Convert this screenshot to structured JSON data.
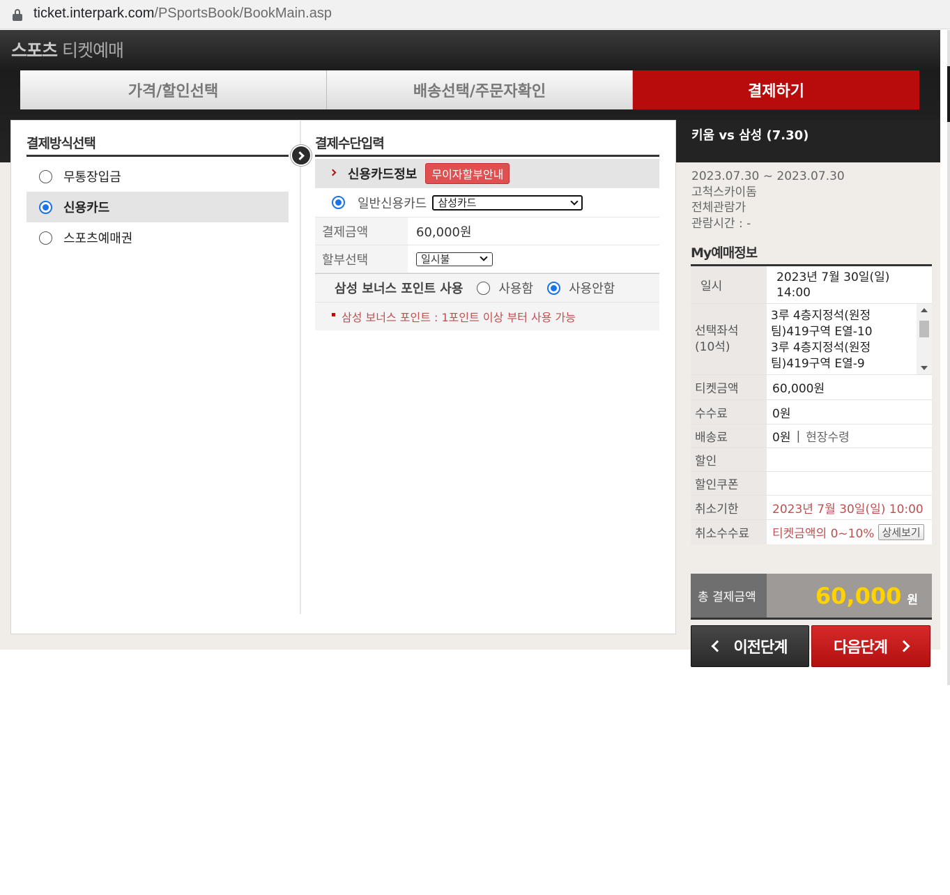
{
  "browser": {
    "url_host": "ticket.interpark.com",
    "url_path": "/PSportsBook/BookMain.asp"
  },
  "header": {
    "brand_bold": "스포츠",
    "brand_light": " 티켓예매"
  },
  "steps": [
    {
      "label": "가격/할인선택",
      "active": false
    },
    {
      "label": "배송선택/주문자확인",
      "active": false
    },
    {
      "label": "결제하기",
      "active": true
    }
  ],
  "payment_methods": {
    "title": "결제방식선택",
    "items": [
      {
        "label": "무통장입금",
        "selected": false
      },
      {
        "label": "신용카드",
        "selected": true
      },
      {
        "label": "스포츠예매권",
        "selected": false
      }
    ]
  },
  "payment_input": {
    "title": "결제수단입력",
    "card_info_label": "신용카드정보",
    "interest_free_badge": "무이자할부안내",
    "card_type_label": "일반신용카드",
    "card_select_value": "삼성카드",
    "amount_label": "결제금액",
    "amount_value": "60,000원",
    "installment_label": "할부선택",
    "installment_value": "일시불",
    "bonus_label": "삼성 보너스 포인트 사용",
    "bonus_use": "사용함",
    "bonus_nouse": "사용안함",
    "bonus_note": "삼성 보너스 포인트 : 1포인트 이상 부터 사용 가능"
  },
  "match": {
    "title": "키움 vs 삼성 (7.30)",
    "period": "2023.07.30 ~ 2023.07.30",
    "venue": "고척스카이돔",
    "rating": "전체관람가",
    "runtime": "관람시간 : -"
  },
  "my_booking": {
    "title": "My예매정보",
    "datetime_label": "일시",
    "datetime_value_1": "2023년 7월 30일(일)",
    "datetime_value_2": "14:00",
    "seat_label_1": "선택좌석",
    "seat_label_2": "(10석)",
    "seats": [
      "3루 4층지정석(원정",
      "팀)419구역 E열-10",
      "3루 4층지정석(원정",
      "팀)419구역 E열-9"
    ],
    "ticket_label": "티켓금액",
    "ticket_value": "60,000원",
    "fee_label": "수수료",
    "fee_value": "0원",
    "delivery_label": "배송료",
    "delivery_value": "0원",
    "delivery_method": "현장수령",
    "discount_label": "할인",
    "coupon_label": "할인쿠폰",
    "cancel_deadline_label": "취소기한",
    "cancel_deadline_value": "2023년 7월 30일(일) 10:00",
    "cancel_fee_label": "취소수수료",
    "cancel_fee_value": "티켓금액의 0~10%",
    "detail_button": "상세보기",
    "total_label": "총 결제금액",
    "total_amount": "60,000",
    "total_unit": "원"
  },
  "nav": {
    "prev_label": "이전단계",
    "next_label": "다음단계"
  },
  "colors": {
    "accent_red": "#b80c0c",
    "total_yellow": "#ffd200",
    "radio_blue": "#1a73e8"
  }
}
